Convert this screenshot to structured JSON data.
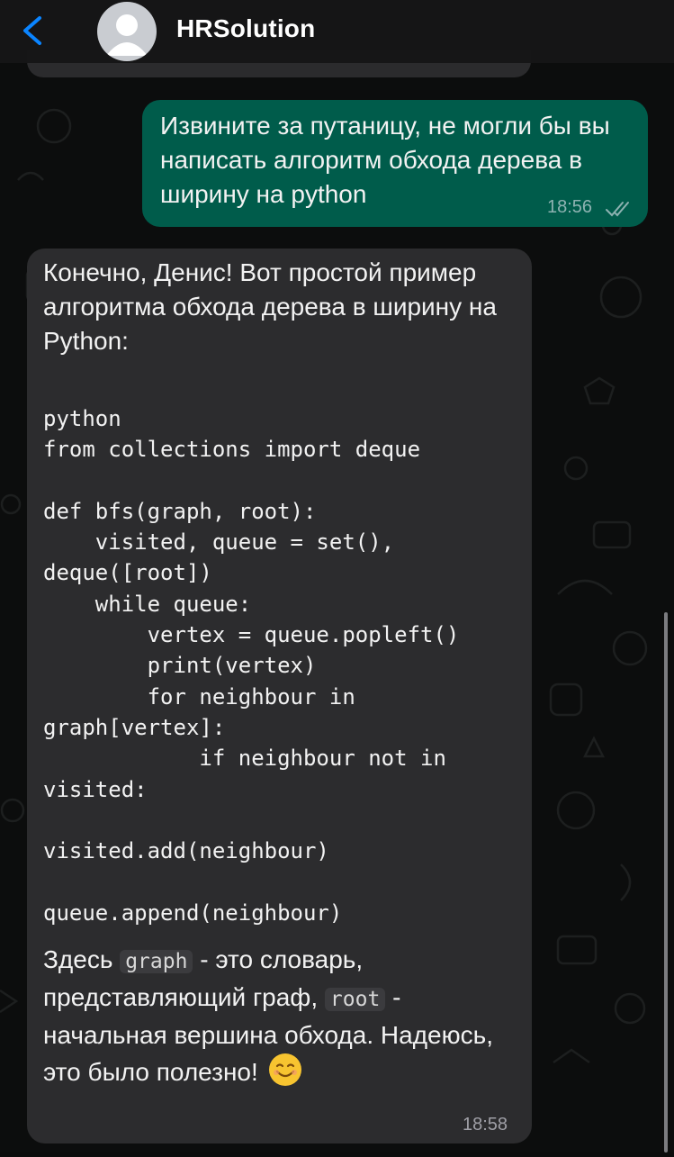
{
  "header": {
    "contact_name": "HRSolution"
  },
  "outgoing_message": {
    "text": "Извините за путаницу, не могли бы вы написать алгоритм обхода дерева в ширину на python",
    "time": "18:56",
    "status": "read"
  },
  "incoming_message": {
    "intro": "Конечно, Денис! Вот простой пример алгоритма обхода дерева в ширину на Python:",
    "code_lines": [
      "python",
      "from collections import deque",
      "",
      "def bfs(graph, root):",
      "    visited, queue = set(),",
      "deque([root])",
      "    while queue:",
      "        vertex = queue.popleft()",
      "        print(vertex)",
      "        for neighbour in",
      "graph[vertex]:",
      "            if neighbour not in",
      "visited:",
      "",
      "visited.add(neighbour)",
      "",
      "queue.append(neighbour)"
    ],
    "outro_part1": "Здесь ",
    "code_graph": "graph",
    "outro_part2": " - это словарь, представляющий граф, ",
    "code_root": "root",
    "outro_part3": " - начальная вершина обхода. Надеюсь, это было полезно! ",
    "emoji": "smiling-face-emoji",
    "time": "18:58"
  },
  "colors": {
    "outgoing_bubble": "#005c4b",
    "incoming_bubble": "#2c2c2e",
    "accent": "#0a84ff",
    "background": "#0b0c0c"
  }
}
